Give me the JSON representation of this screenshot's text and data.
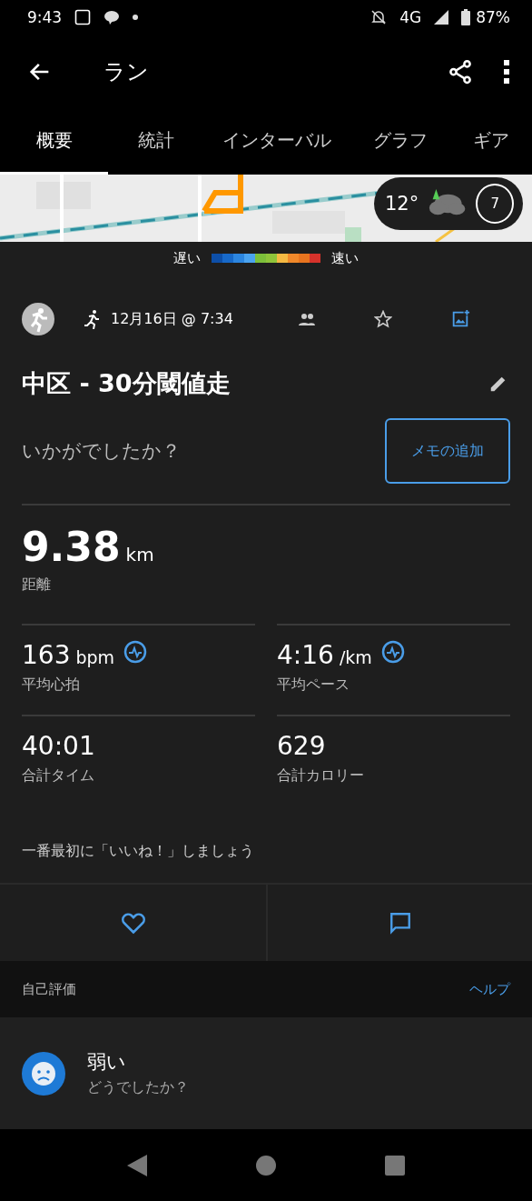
{
  "status_bar": {
    "time": "9:43",
    "network": "4G",
    "battery": "87%"
  },
  "toolbar": {
    "title": "ラン"
  },
  "tabs": [
    {
      "label": "概要",
      "selected": true
    },
    {
      "label": "統計",
      "selected": false
    },
    {
      "label": "インターバル",
      "selected": false
    },
    {
      "label": "グラフ",
      "selected": false
    },
    {
      "label": "ギア",
      "selected": false
    }
  ],
  "map": {
    "weather": {
      "temperature": "12°",
      "wind": "7"
    }
  },
  "pace_legend": {
    "slow": "遅い",
    "fast": "速い"
  },
  "activity": {
    "date": "12月16日 @ 7:34",
    "title": "中区 - 30分閾値走",
    "prompt": "いかがでしたか？",
    "add_note": "メモの追加"
  },
  "distance": {
    "value": "9.38",
    "unit": "km",
    "label": "距離"
  },
  "stats": [
    {
      "value": "163",
      "unit": "bpm",
      "label": "平均心拍",
      "chart_icon": true
    },
    {
      "value": "4:16",
      "unit": "/km",
      "label": "平均ペース",
      "chart_icon": true
    },
    {
      "value": "40:01",
      "label": "合計タイム",
      "chart_icon": false
    },
    {
      "value": "629",
      "label": "合計カロリー",
      "chart_icon": false
    }
  ],
  "like_text": "一番最初に「いいね！」しましょう",
  "self_evaluation": {
    "header": "自己評価",
    "help": "ヘルプ",
    "rating": "弱い",
    "question": "どうでしたか？"
  }
}
